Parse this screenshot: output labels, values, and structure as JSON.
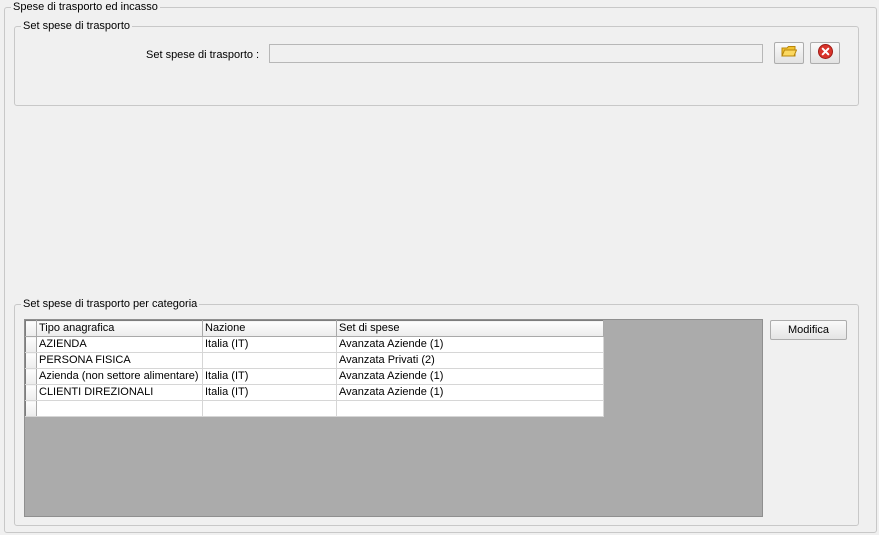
{
  "outer_group": {
    "title": "Spese di trasporto ed incasso"
  },
  "set_spese_group": {
    "title": "Set spese di trasporto",
    "field_label": "Set spese di trasporto :",
    "field_value": "",
    "open_icon": "folder-open-icon",
    "clear_icon": "red-x-icon"
  },
  "categoria_group": {
    "title": "Set spese di trasporto per categoria",
    "modifica_label": "Modifica",
    "columns": [
      "Tipo anagrafica",
      "Nazione",
      "Set di spese"
    ],
    "rows": [
      [
        "AZIENDA",
        "Italia (IT)",
        "Avanzata Aziende (1)"
      ],
      [
        "PERSONA FISICA",
        "",
        "Avanzata Privati (2)"
      ],
      [
        "Azienda (non settore alimentare)",
        "Italia (IT)",
        "Avanzata Aziende (1)"
      ],
      [
        "CLIENTI DIREZIONALI",
        "Italia (IT)",
        "Avanzata Aziende (1)"
      ],
      [
        "",
        "",
        ""
      ]
    ]
  },
  "colors": {
    "window_bg": "#f0f0f0",
    "grid_bg": "#ababab",
    "clear_red": "#d9342b",
    "folder_yellow": "#f2c230"
  }
}
